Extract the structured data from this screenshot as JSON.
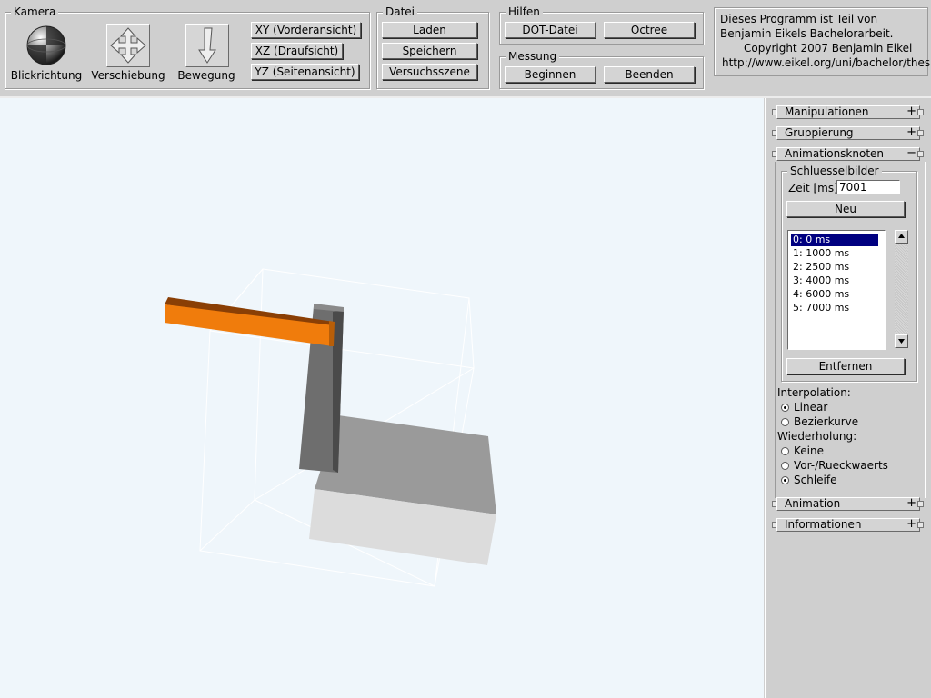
{
  "window": {
    "title": "Benjamin Eikels Bachelorarbeit"
  },
  "camera": {
    "legend": "Kamera",
    "tools": [
      {
        "label": "Blickrichtung",
        "icon": "sphere-icon"
      },
      {
        "label": "Verschiebung",
        "icon": "move-arrows-icon"
      },
      {
        "label": "Bewegung",
        "icon": "forward-arrow-icon"
      }
    ],
    "views": [
      "XY (Vorderansicht)",
      "XZ (Draufsicht)",
      "YZ (Seitenansicht)"
    ]
  },
  "file": {
    "legend": "Datei",
    "buttons": [
      "Laden",
      "Speichern",
      "Versuchsszene"
    ]
  },
  "help": {
    "legend": "Hilfen",
    "buttons": [
      "DOT-Datei",
      "Octree"
    ]
  },
  "measure": {
    "legend": "Messung",
    "buttons": [
      "Beginnen",
      "Beenden"
    ]
  },
  "info": {
    "lines": [
      "Dieses Programm ist Teil von",
      "Benjamin Eikels Bachelorarbeit.",
      "Copyright 2007 Benjamin Eikel",
      "http://www.eikel.org/uni/bachelor/thesis"
    ]
  },
  "panel": {
    "sections": {
      "manipulation": {
        "title": "Manipulationen",
        "sym": "+"
      },
      "group": {
        "title": "Gruppierung",
        "sym": "+"
      },
      "anim_node": {
        "title": "Animationsknoten",
        "sym": "−"
      },
      "animation": {
        "title": "Animation",
        "sym": "+"
      },
      "info": {
        "title": "Informationen",
        "sym": "+"
      }
    },
    "keyframes": {
      "legend": "Schluesselbilder",
      "time_label": "Zeit [ms]:",
      "time_value": "7001",
      "new_button": "Neu",
      "remove_button": "Entfernen",
      "items": [
        "0: 0 ms",
        "1: 1000 ms",
        "2: 2500 ms",
        "3: 4000 ms",
        "4: 6000 ms",
        "5: 7000 ms"
      ],
      "selected_index": 0
    },
    "interpolation": {
      "label": "Interpolation:",
      "options": [
        "Linear",
        "Bezierkurve"
      ],
      "selected": "Linear"
    },
    "repeat": {
      "label": "Wiederholung:",
      "options": [
        "Keine",
        "Vor-/Rueckwaerts",
        "Schleife"
      ],
      "selected": "Schleife"
    }
  },
  "colors": {
    "viewport_bg": "#eff6fb",
    "panel_bg": "#cfcfcf",
    "orange_bar": "#f07c0c",
    "selection": "#000080"
  }
}
